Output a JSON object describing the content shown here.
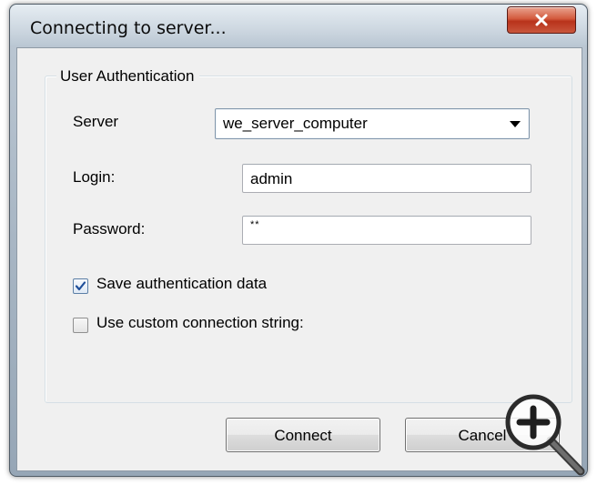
{
  "window": {
    "title": "Connecting to server...",
    "close_glyph": "X",
    "icons": {
      "close": "close-icon"
    }
  },
  "group": {
    "legend": "User Authentication"
  },
  "fields": {
    "server_label": "Server",
    "server_value": "we_server_computer",
    "login_label": "Login:",
    "login_value": "admin",
    "password_label": "Password:",
    "password_mask": "**"
  },
  "checkboxes": [
    {
      "label": "Save authentication data",
      "checked": true
    },
    {
      "label": "Use custom connection string:",
      "checked": false
    }
  ],
  "buttons": {
    "connect": "Connect",
    "cancel": "Cancel"
  },
  "overlay": {
    "icon": "zoom-in-icon"
  },
  "colors": {
    "close_button": "#c9412a",
    "checkbox_check": "#1f4f9a"
  }
}
